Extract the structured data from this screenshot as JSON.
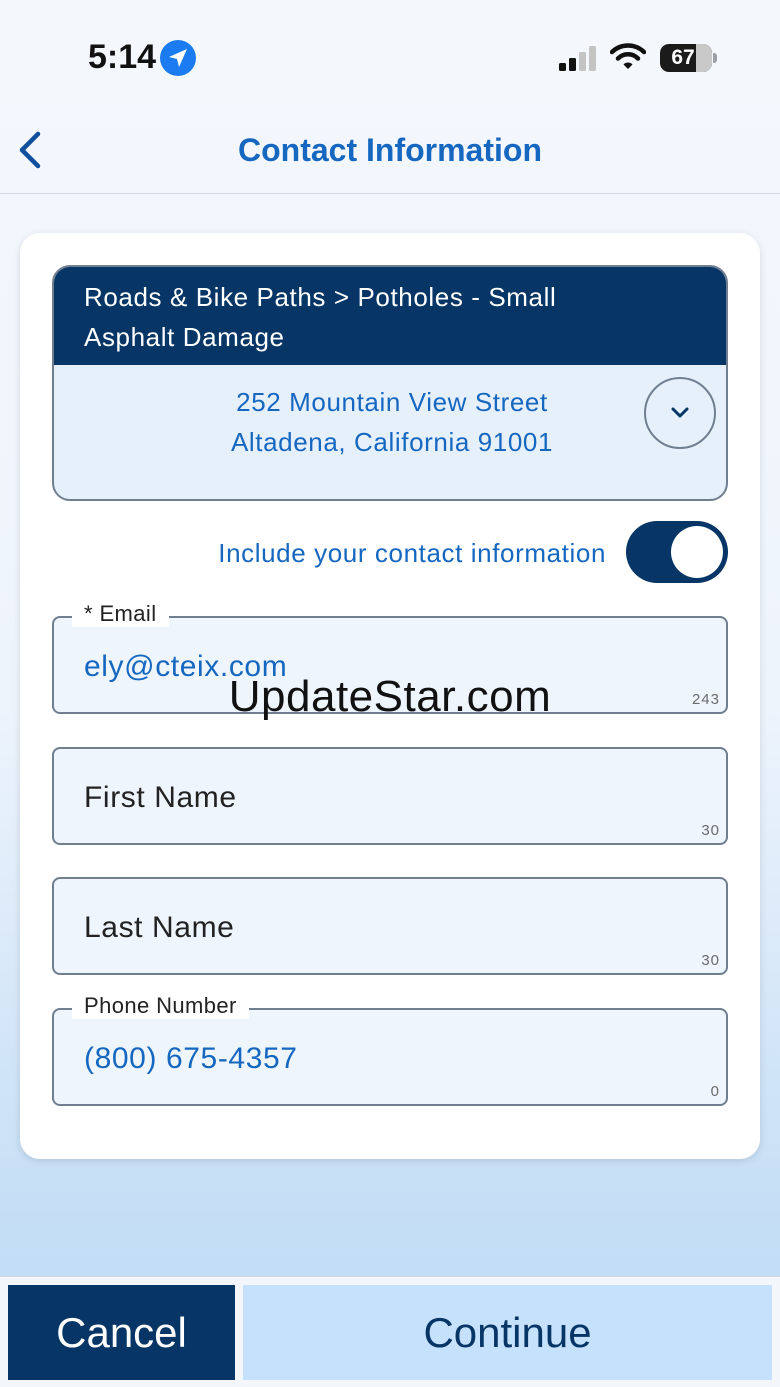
{
  "status_bar": {
    "time": "5:14",
    "battery": "67",
    "icons": [
      "location-arrow-icon",
      "cellular-signal-icon",
      "wifi-icon",
      "battery-icon"
    ]
  },
  "nav": {
    "title": "Contact Information",
    "back_icon": "chevron-left-icon"
  },
  "request": {
    "category_line1": "Roads & Bike Paths > Potholes - Small",
    "category_line2": "Asphalt Damage",
    "address_line1": "252 Mountain View Street",
    "address_line2": "Altadena, California 91001",
    "expand_icon": "chevron-down-icon"
  },
  "contact_toggle": {
    "label": "Include your contact information",
    "on": true
  },
  "fields": {
    "email": {
      "label": "* Email",
      "value": "ely@cteix.com",
      "counter": "243"
    },
    "first_name": {
      "placeholder": "First Name",
      "counter": "30"
    },
    "last_name": {
      "placeholder": "Last Name",
      "counter": "30"
    },
    "phone": {
      "label": "Phone Number",
      "value": "(800) 675-4357",
      "counter": "0"
    }
  },
  "watermark": "UpdateStar.com",
  "actions": {
    "cancel_label": "Cancel",
    "continue_label": "Continue"
  },
  "colors": {
    "primary_dark": "#063566",
    "link_blue": "#1667c0",
    "continue_bg": "#c5e1fb",
    "field_bg": "#eef5fd"
  }
}
